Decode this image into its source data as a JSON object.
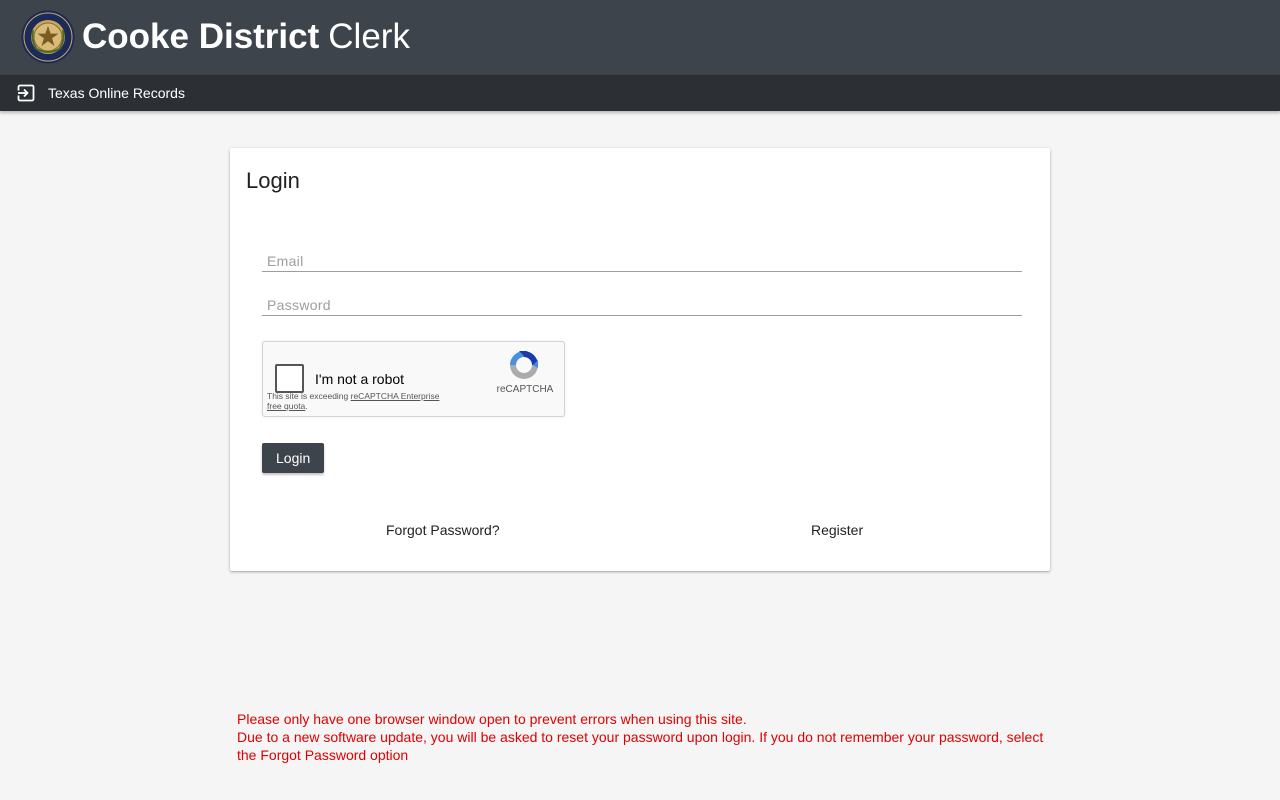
{
  "header": {
    "title_bold": "Cooke District",
    "title_light": "Clerk",
    "seal_icon": "texas-state-seal-icon"
  },
  "subnav": {
    "icon": "sign-in-icon",
    "link_label": "Texas Online Records"
  },
  "login": {
    "title": "Login",
    "email_placeholder": "Email",
    "email_value": "",
    "password_placeholder": "Password",
    "password_value": "",
    "button_label": "Login",
    "forgot_label": "Forgot Password?",
    "register_label": "Register"
  },
  "recaptcha": {
    "label": "I'm not a robot",
    "brand": "reCAPTCHA",
    "notice_prefix": "This site is exceeding ",
    "notice_link": "reCAPTCHA Enterprise free quota",
    "notice_suffix": "."
  },
  "notices": [
    "Please only have one browser window open to prevent errors when using this site.",
    "Due to a new software update, you will be asked to reset your password upon login. If you do not remember your password, select the Forgot Password option"
  ],
  "colors": {
    "header_bg": "#3d444c",
    "subnav_bg": "#2c3035",
    "page_bg": "#f5f5f5",
    "notice_text": "#e00000",
    "button_bg": "#3d444c"
  }
}
